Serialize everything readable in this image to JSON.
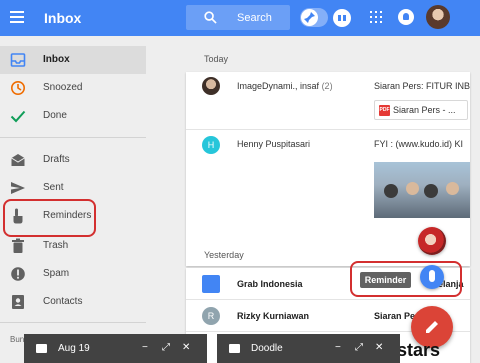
{
  "appbar": {
    "title": "Inbox",
    "search_label": "Search",
    "icons": [
      "hamburger-icon",
      "search-icon",
      "pin-toggle",
      "bundle-icon",
      "apps-icon",
      "notifications-icon"
    ],
    "color": "#4285f4"
  },
  "sidebar": {
    "items": [
      {
        "label": "Inbox",
        "icon": "inbox-icon",
        "active": true
      },
      {
        "label": "Snoozed",
        "icon": "clock-icon"
      },
      {
        "label": "Done",
        "icon": "check-icon"
      },
      {
        "label": "Drafts",
        "icon": "drafts-icon"
      },
      {
        "label": "Sent",
        "icon": "send-icon"
      },
      {
        "label": "Reminders",
        "icon": "reminder-hand-icon",
        "highlighted": true
      },
      {
        "label": "Trash",
        "icon": "trash-icon"
      },
      {
        "label": "Spam",
        "icon": "spam-icon"
      },
      {
        "label": "Contacts",
        "icon": "contacts-icon"
      }
    ],
    "bundled_label": "Bun"
  },
  "main": {
    "sections": [
      {
        "heading": "Today",
        "rows": [
          {
            "sender": "ImageDynami., insaf",
            "count": "(2)",
            "subject": "Siaran Pers: FITUR INB",
            "attachment": "Siaran Pers - ..."
          },
          {
            "avatar_letter": "H",
            "avatar_color": "#26c6da",
            "sender": "Henny Puspitasari",
            "subject": "FYI : (www.kudo.id) KI"
          }
        ]
      },
      {
        "heading": "Yesterday",
        "rows": [
          {
            "sender": "Grab Indonesia",
            "subject": "elanja",
            "bold": true
          },
          {
            "avatar_letter": "R",
            "avatar_color": "#90a4ae",
            "sender": "Rizky Kurniawan",
            "subject": "Siaran Pers",
            "bold": true
          }
        ]
      }
    ]
  },
  "reminder_tooltip": "Reminder",
  "compose_windows": [
    {
      "title": "Aug 19"
    },
    {
      "title": "Doodle"
    }
  ],
  "compose_controls": {
    "minimize": "−",
    "expand": "⤢",
    "close": "✕"
  },
  "watermark": "edstars"
}
